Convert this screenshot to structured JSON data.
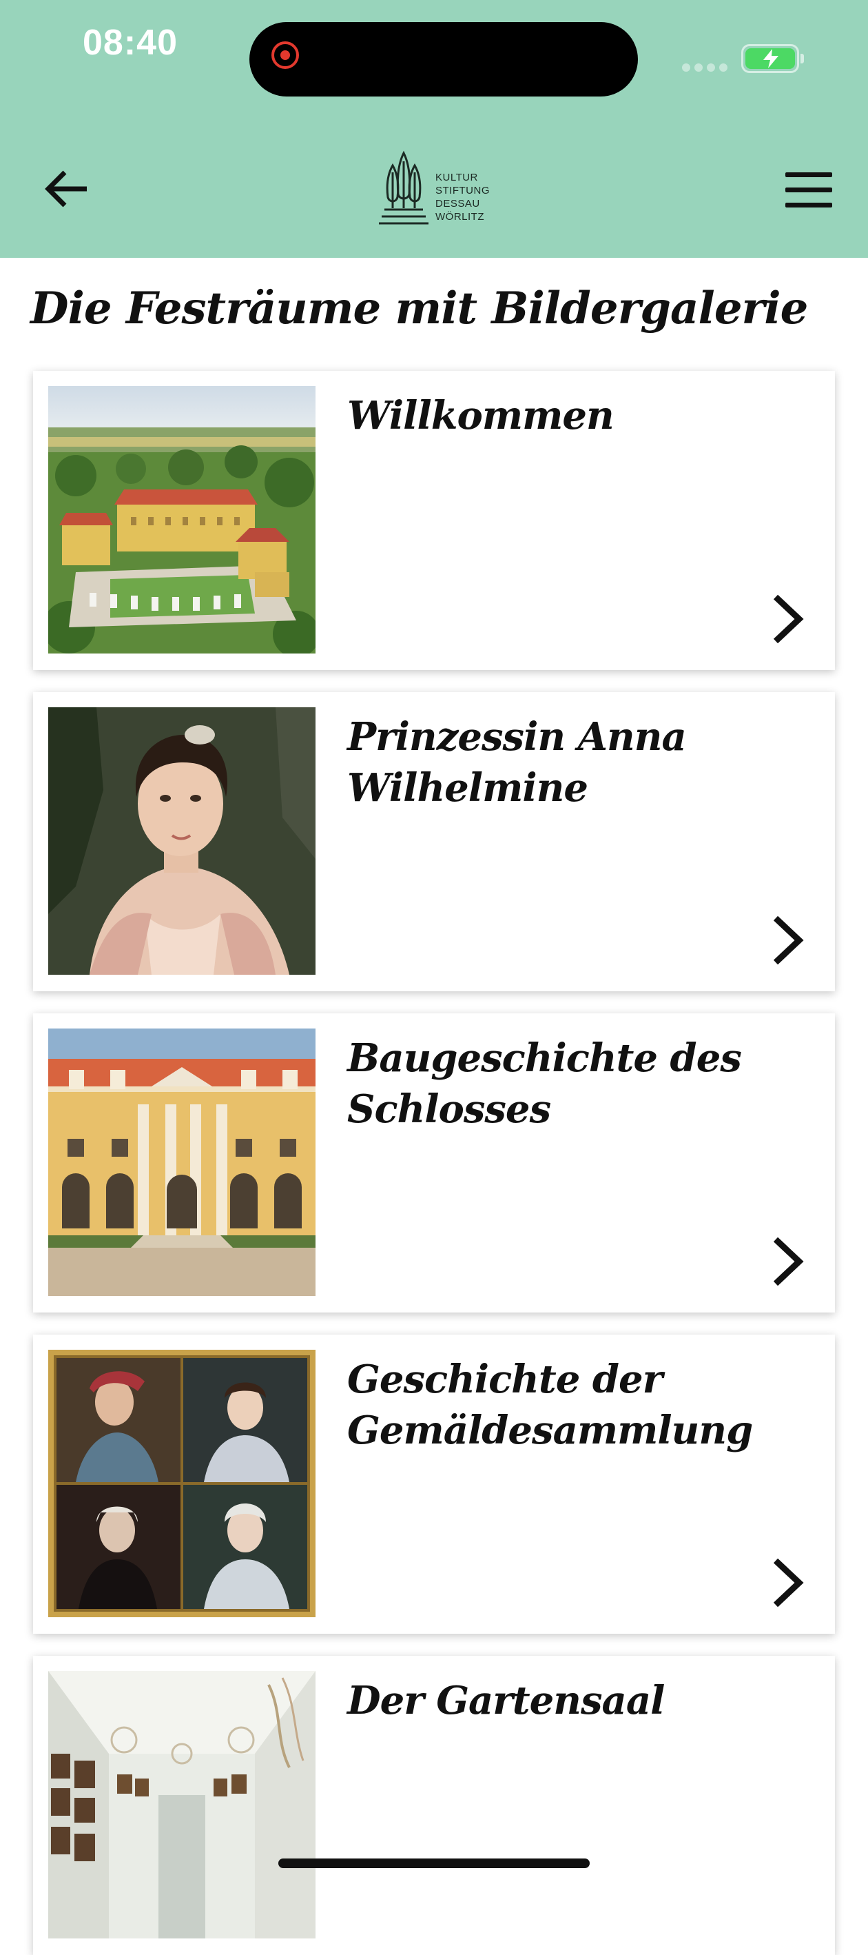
{
  "status_bar": {
    "time": "08:40",
    "battery_color": "#4cd964"
  },
  "header": {
    "background": "#98d4bb",
    "back_icon": "arrow-left-icon",
    "menu_icon": "hamburger-menu-icon",
    "logo_icon": "kulturstiftung-logo-icon",
    "logo_text": "KULTUR\nSTIFTUNG\nDESSAU\nWÖRLITZ"
  },
  "page": {
    "title": "Die Festräume mit Bildergalerie"
  },
  "cards": [
    {
      "title": "Willkommen",
      "thumb": "castle-aerial-image",
      "chevron": "chevron-right-icon"
    },
    {
      "title": "Prinzessin Anna Wilhelmine",
      "thumb": "princess-portrait-image",
      "chevron": "chevron-right-icon"
    },
    {
      "title": "Baugeschichte des Schlosses",
      "thumb": "palace-facade-image",
      "chevron": "chevron-right-icon"
    },
    {
      "title": "Geschichte der Gemäldesammlung",
      "thumb": "portrait-collage-image",
      "chevron": "chevron-right-icon"
    },
    {
      "title": "Der Gartensaal",
      "thumb": "garden-hall-image",
      "chevron": "chevron-right-icon"
    }
  ]
}
